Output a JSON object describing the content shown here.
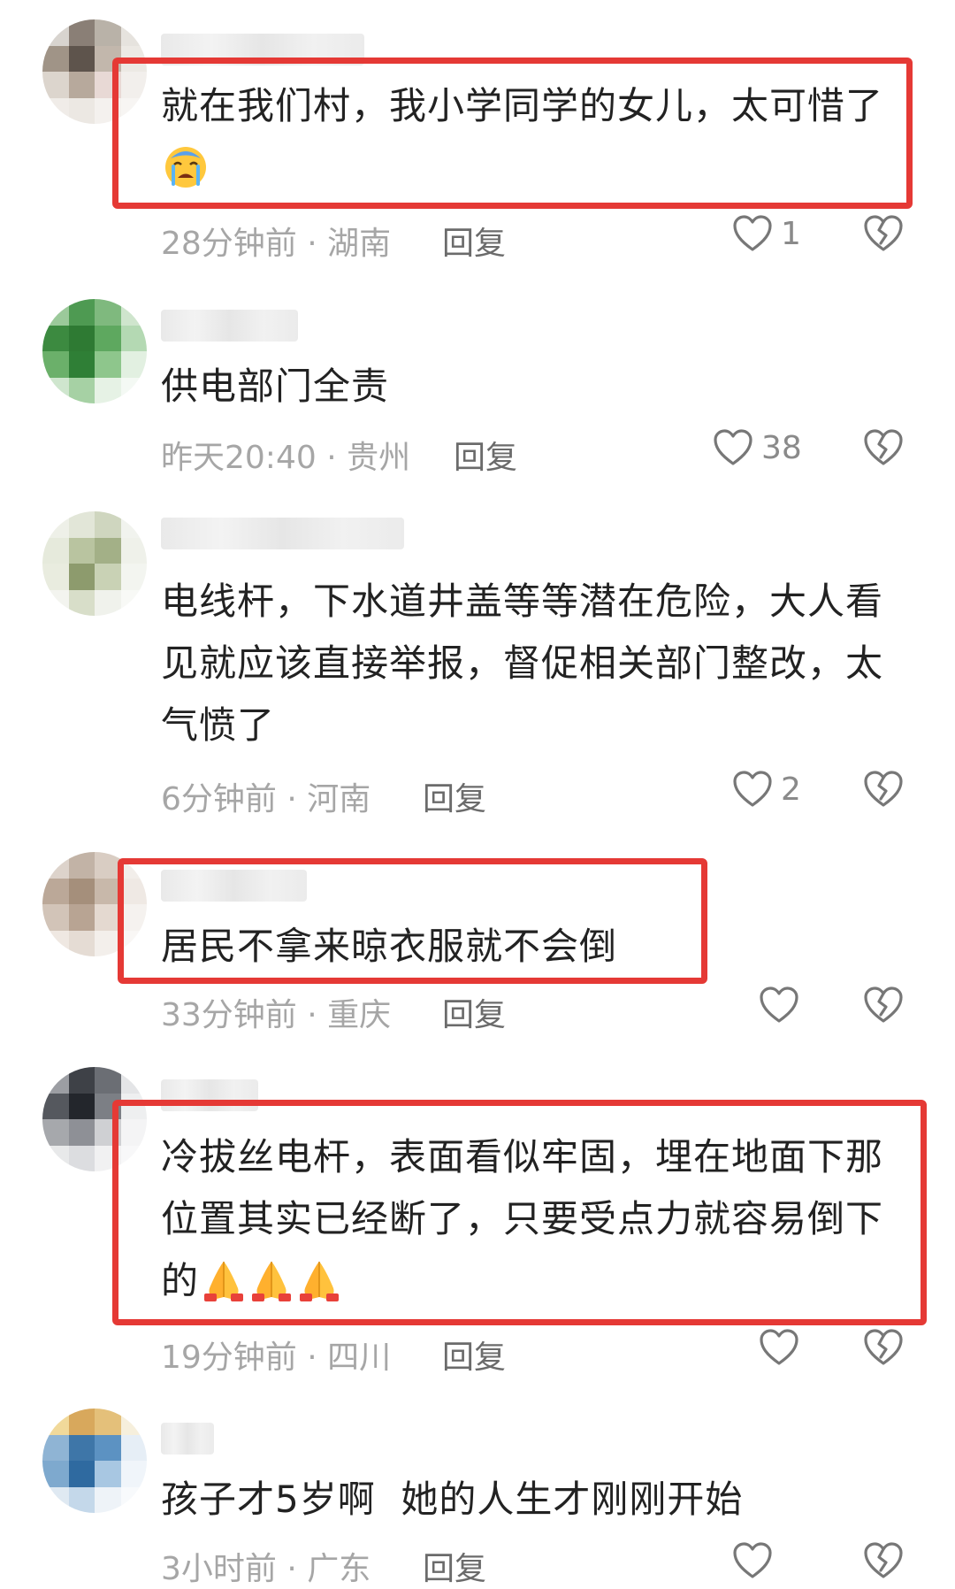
{
  "comments": [
    {
      "text": "就在我们村，我小学同学的女儿，太可惜了",
      "time": "28分钟前",
      "location": "湖南",
      "reply": "回复",
      "likes": "1",
      "highlighted": true
    },
    {
      "text": "供电部门全责",
      "time": "昨天20:40",
      "location": "贵州",
      "reply": "回复",
      "likes": "38",
      "highlighted": false
    },
    {
      "text": "电线杆，下水道井盖等等潜在危险，大人看见就应该直接举报，督促相关部门整改，太气愤了",
      "time": "6分钟前",
      "location": "河南",
      "reply": "回复",
      "likes": "2",
      "highlighted": false
    },
    {
      "text": "居民不拿来晾衣服就不会倒",
      "time": "33分钟前",
      "location": "重庆",
      "reply": "回复",
      "likes": "",
      "highlighted": true
    },
    {
      "text": "冷拔丝电杆，表面看似牢固，埋在地面下那位置其实已经断了，只要受点力就容易倒下的",
      "time": "19分钟前",
      "location": "四川",
      "reply": "回复",
      "likes": "",
      "highlighted": true
    },
    {
      "text": "孩子才5岁啊  她的人生才刚刚开始",
      "time": "3小时前",
      "location": "广东",
      "reply": "回复",
      "likes": "",
      "highlighted": false
    }
  ],
  "meta_separator": " · ",
  "icons": {
    "like": "heart-outline-icon",
    "dislike": "broken-heart-icon",
    "emoji_crying": "loudly-crying-face-emoji",
    "emoji_pray": "folded-hands-emoji"
  },
  "colors": {
    "highlight_border": "#e53935",
    "meta_text": "#a6a6a6",
    "body_text": "#222222"
  }
}
